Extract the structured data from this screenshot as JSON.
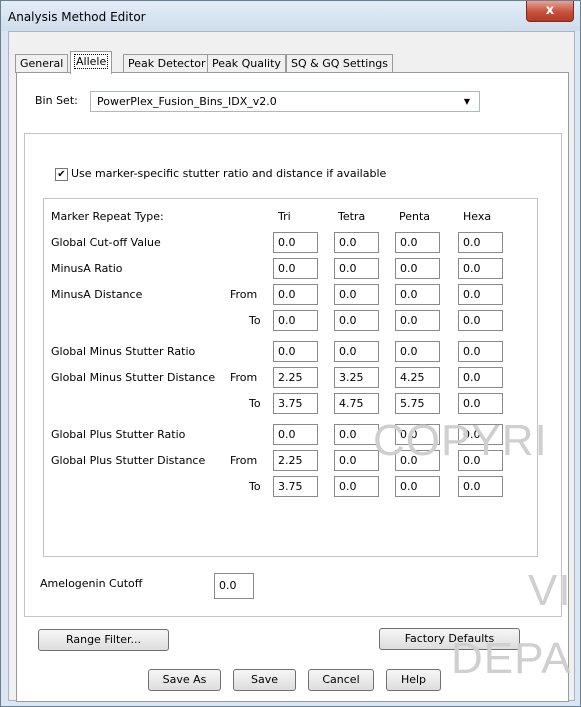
{
  "window": {
    "title": "Analysis Method Editor",
    "close_glyph": "x"
  },
  "tabs": [
    {
      "label": "General"
    },
    {
      "label": "Allele"
    },
    {
      "label": "Peak Detector"
    },
    {
      "label": "Peak Quality"
    },
    {
      "label": "SQ & GQ Settings"
    }
  ],
  "bin_set": {
    "label": "Bin Set:",
    "value": "PowerPlex_Fusion_Bins_IDX_v2.0"
  },
  "checkbox": {
    "label": "Use marker-specific stutter ratio and distance if available",
    "checked": true
  },
  "grid": {
    "header_label": "Marker Repeat Type:",
    "columns": [
      "Tri",
      "Tetra",
      "Penta",
      "Hexa"
    ],
    "rows": [
      {
        "label": "Global Cut-off Value",
        "sub": "",
        "values": [
          "0.0",
          "0.0",
          "0.0",
          "0.0"
        ]
      },
      {
        "label": "MinusA Ratio",
        "sub": "",
        "values": [
          "0.0",
          "0.0",
          "0.0",
          "0.0"
        ]
      },
      {
        "label": "MinusA Distance",
        "sub": "From",
        "values": [
          "0.0",
          "0.0",
          "0.0",
          "0.0"
        ]
      },
      {
        "label": "",
        "sub": "To",
        "values": [
          "0.0",
          "0.0",
          "0.0",
          "0.0"
        ]
      },
      {
        "label": "Global Minus Stutter Ratio",
        "sub": "",
        "values": [
          "0.0",
          "0.0",
          "0.0",
          "0.0"
        ]
      },
      {
        "label": "Global Minus Stutter Distance",
        "sub": "From",
        "values": [
          "2.25",
          "3.25",
          "4.25",
          "0.0"
        ]
      },
      {
        "label": "",
        "sub": "To",
        "values": [
          "3.75",
          "4.75",
          "5.75",
          "0.0"
        ]
      },
      {
        "label": "Global Plus Stutter Ratio",
        "sub": "",
        "values": [
          "0.0",
          "0.0",
          "0.0",
          "0.0"
        ]
      },
      {
        "label": "Global Plus Stutter Distance",
        "sub": "From",
        "values": [
          "2.25",
          "0.0",
          "0.0",
          "0.0"
        ]
      },
      {
        "label": "",
        "sub": "To",
        "values": [
          "3.75",
          "0.0",
          "0.0",
          "0.0"
        ]
      }
    ]
  },
  "amelogenin": {
    "label": "Amelogenin Cutoff",
    "value": "0.0"
  },
  "buttons": {
    "range_filter": "Range Filter...",
    "factory_defaults": "Factory Defaults",
    "save_as": "Save As",
    "save": "Save",
    "cancel": "Cancel",
    "help": "Help"
  },
  "watermark": {
    "line1": "COPYRI",
    "line2": "VI",
    "line3": "DEPA"
  }
}
